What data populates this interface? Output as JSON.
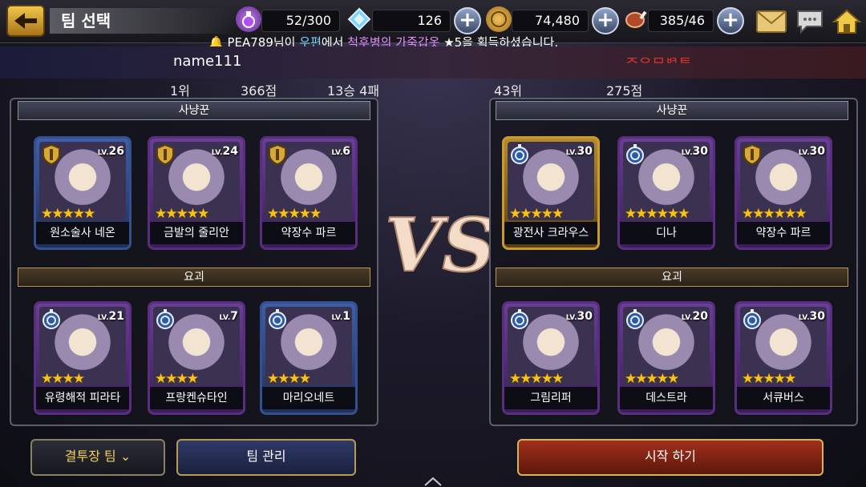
{
  "header": {
    "title": "팀 선택",
    "stamina": "52/300",
    "crystals": "126",
    "gold": "74,480",
    "meat": "385/46"
  },
  "ticker": {
    "prefix": "PEA789님이 ",
    "source": "우편",
    "mid": "에서 ",
    "item": "척후병의 가죽갑옷",
    "suffix": " ★5을 획득하셨습니다."
  },
  "left_player": {
    "name": "name111",
    "rank": "1위",
    "points": "366점",
    "record": "13승 4패",
    "hunters_label": "사냥꾼",
    "yokai_label": "요괴",
    "hunters": [
      {
        "name": "원소술사 네온",
        "level": "26",
        "stars": 5,
        "frame": "blue",
        "badge": "shield"
      },
      {
        "name": "금발의 줄리안",
        "level": "24",
        "stars": 5,
        "frame": "purple",
        "badge": "shield"
      },
      {
        "name": "약장수 파르",
        "level": "6",
        "stars": 5,
        "frame": "purple",
        "badge": "shield"
      }
    ],
    "yokai": [
      {
        "name": "유령해적 피라타",
        "level": "21",
        "stars": 4,
        "frame": "purple",
        "badge": "orb"
      },
      {
        "name": "프랑켄슈타인",
        "level": "7",
        "stars": 4,
        "frame": "purple",
        "badge": "orb"
      },
      {
        "name": "마리오네트",
        "level": "1",
        "stars": 4,
        "frame": "blue",
        "badge": "orb"
      }
    ]
  },
  "right_player": {
    "name": "ᄌᄋᄆᄇᄏᄐ",
    "rank": "43위",
    "points": "275점",
    "hunters_label": "사냥꾼",
    "yokai_label": "요괴",
    "hunters": [
      {
        "name": "광전사 크라우스",
        "level": "30",
        "stars": 5,
        "frame": "gold",
        "badge": "orb"
      },
      {
        "name": "디나",
        "level": "30",
        "stars": 6,
        "frame": "purple",
        "badge": "orb"
      },
      {
        "name": "약장수 파르",
        "level": "30",
        "stars": 6,
        "frame": "purple",
        "badge": "shield"
      }
    ],
    "yokai": [
      {
        "name": "그림리퍼",
        "level": "30",
        "stars": 5,
        "frame": "purple",
        "badge": "orb"
      },
      {
        "name": "데스트라",
        "level": "20",
        "stars": 5,
        "frame": "purple",
        "badge": "orb"
      },
      {
        "name": "서큐버스",
        "level": "30",
        "stars": 5,
        "frame": "purple",
        "badge": "orb"
      }
    ]
  },
  "vs_label": "VS",
  "buttons": {
    "arena_team": "결투장 팀",
    "team_manage": "팀 관리",
    "start": "시작 하기"
  },
  "colors": {
    "star": "#f8c21c",
    "gold_accent": "#f0d060",
    "right_name": "#d8352a"
  }
}
